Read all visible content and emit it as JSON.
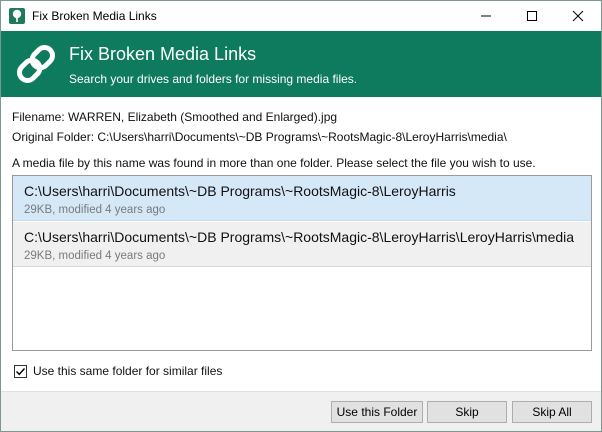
{
  "window": {
    "title": "Fix Broken Media Links"
  },
  "banner": {
    "title": "Fix Broken Media Links",
    "subtitle": "Search your drives and folders for missing media files."
  },
  "info": {
    "filename": "Filename: WARREN, Elizabeth (Smoothed and Enlarged).jpg",
    "original_folder": "Original Folder: C:\\Users\\harri\\Documents\\~DB Programs\\~RootsMagic-8\\LeroyHarris\\media\\",
    "instruction": "A media file by this name was found in more than one folder. Please select the file you wish to use."
  },
  "results": [
    {
      "path": "C:\\Users\\harri\\Documents\\~DB Programs\\~RootsMagic-8\\LeroyHarris",
      "meta": "29KB, modified 4 years ago",
      "selected": true
    },
    {
      "path": "C:\\Users\\harri\\Documents\\~DB Programs\\~RootsMagic-8\\LeroyHarris\\LeroyHarris\\media",
      "meta": "29KB, modified 4 years ago",
      "selected": false
    }
  ],
  "options": {
    "same_folder_label": "Use this same folder for similar files",
    "same_folder_checked": true
  },
  "buttons": {
    "use_folder": "Use this Folder",
    "skip": "Skip",
    "skip_all": "Skip All"
  },
  "colors": {
    "banner": "#0e7a5e",
    "selection": "#d5e8f8"
  },
  "icons": {
    "app": "tree-icon",
    "banner": "link-icon",
    "minimize": "minimize-icon",
    "maximize": "maximize-icon",
    "close": "close-icon",
    "check": "checkmark-icon"
  }
}
